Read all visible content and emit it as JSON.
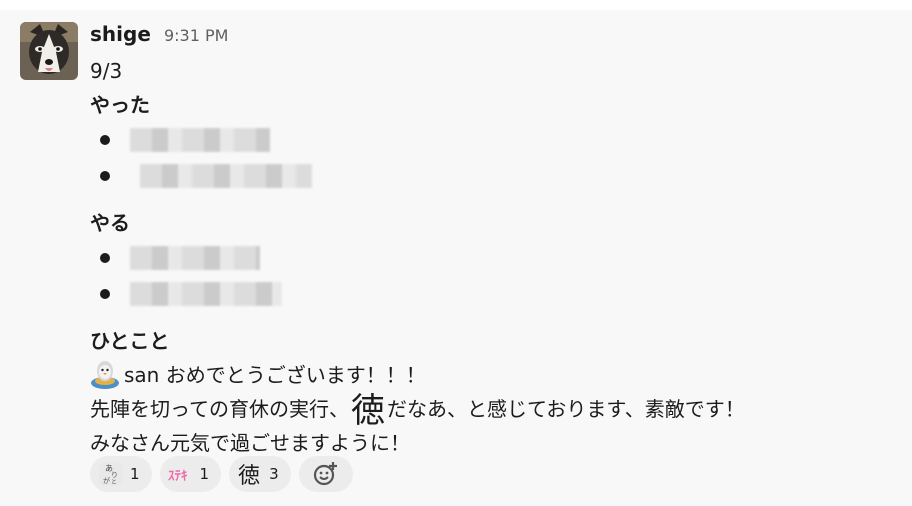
{
  "message": {
    "author": "shige",
    "time": "9:31 PM",
    "date_line": "9/3",
    "done_heading": "やった",
    "todo_heading": "やる",
    "comment_heading": "ひとこと",
    "done_items": [
      {
        "redacted": true
      },
      {
        "redacted": true
      }
    ],
    "todo_items": [
      {
        "redacted": true
      },
      {
        "redacted": true
      }
    ],
    "comment_line1_suffix": "san おめでとうございます！！！",
    "comment_line2_before": "先陣を切っての育休の実行、",
    "inline_emoji": "徳",
    "comment_line2_after": "だなあ、と感じております、素敵です！",
    "comment_line3": "みなさん元気で過ごせますように！"
  },
  "reactions": [
    {
      "icon": "arigato-icon",
      "label": "ありがとう",
      "count": "1"
    },
    {
      "icon": "suteki-icon",
      "label": "ステキ",
      "count": "1"
    },
    {
      "icon": "toku-icon",
      "label": "徳",
      "count": "3"
    }
  ],
  "add_reaction": {
    "icon": "add-reaction-icon"
  }
}
